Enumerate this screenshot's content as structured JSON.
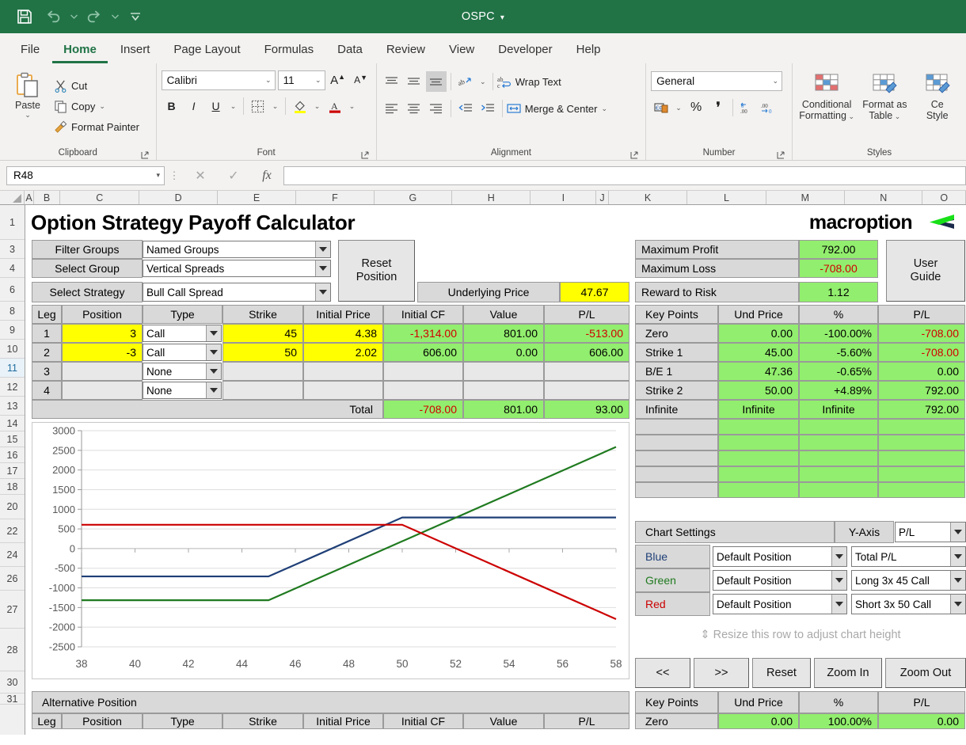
{
  "titlebar": {
    "doc_title": "OSPC",
    "caret": "▾",
    "qat": [
      {
        "name": "save-icon",
        "label": "Save"
      },
      {
        "name": "undo-icon",
        "label": "Undo"
      },
      {
        "name": "redo-icon",
        "label": "Redo"
      },
      {
        "name": "customize-qat-icon",
        "label": "Customize Quick Access Toolbar"
      }
    ],
    "accent": "#217346"
  },
  "ribbon": {
    "tabs": [
      {
        "label": "File",
        "active": false
      },
      {
        "label": "Home",
        "active": true
      },
      {
        "label": "Insert",
        "active": false
      },
      {
        "label": "Page Layout",
        "active": false
      },
      {
        "label": "Formulas",
        "active": false
      },
      {
        "label": "Data",
        "active": false
      },
      {
        "label": "Review",
        "active": false
      },
      {
        "label": "View",
        "active": false
      },
      {
        "label": "Developer",
        "active": false
      },
      {
        "label": "Help",
        "active": false
      }
    ],
    "clipboard": {
      "group_label": "Clipboard",
      "paste": "Paste",
      "cut": "Cut",
      "copy": "Copy",
      "format_painter": "Format Painter"
    },
    "font": {
      "group_label": "Font",
      "font_name": "Calibri",
      "font_size": "11",
      "grow": "A",
      "shrink": "A",
      "bold": "B",
      "italic": "I",
      "underline": "U",
      "borders": "Borders",
      "fill": "Fill Color",
      "fontcolor": "A"
    },
    "alignment": {
      "group_label": "Alignment",
      "wrap_text": "Wrap Text",
      "merge_center": "Merge & Center",
      "orientation": "Orientation",
      "indent_dec": "Decrease Indent",
      "indent_inc": "Increase Indent"
    },
    "number": {
      "group_label": "Number",
      "format": "General",
      "percent": "%",
      "comma": "❜",
      "dec_inc": ".00",
      "dec_dec": ".00"
    },
    "styles": {
      "group_label": "Styles",
      "conditional_formatting": "Conditional\nFormatting",
      "conditional_formatting_l1": "Conditional",
      "conditional_formatting_l2": "Formatting",
      "format_as_table_l1": "Format as",
      "format_as_table_l2": "Table",
      "cell_styles_l1": "Ce",
      "cell_styles_l2": "Style"
    }
  },
  "formula_bar": {
    "name_box": "R48",
    "cancel": "✕",
    "enter": "✓",
    "fx": "fx",
    "formula": ""
  },
  "grid": {
    "columns": [
      "A",
      "B",
      "C",
      "D",
      "E",
      "F",
      "G",
      "H",
      "I",
      "J",
      "K",
      "L",
      "M",
      "N",
      "O"
    ],
    "rows": [
      "1",
      "3",
      "4",
      "6",
      "8",
      "9",
      "10",
      "11",
      "12",
      "13",
      "14",
      "15",
      "16",
      "17",
      "18",
      "20",
      "22",
      "24",
      "26",
      "27",
      "28",
      "30",
      "31"
    ],
    "highlight_row": "11"
  },
  "sheet": {
    "title": "Option Strategy Payoff Calculator",
    "brand": "macroption",
    "filters": {
      "filter_groups_label": "Filter Groups",
      "filter_groups_value": "Named Groups",
      "select_group_label": "Select Group",
      "select_group_value": "Vertical Spreads",
      "select_strategy_label": "Select Strategy",
      "select_strategy_value": "Bull Call Spread",
      "reset_position_l1": "Reset",
      "reset_position_l2": "Position"
    },
    "underlying": {
      "label": "Underlying Price",
      "value": "47.67"
    },
    "legs": {
      "headers": [
        "Leg",
        "Position",
        "Type",
        "Strike",
        "Initial Price",
        "Initial CF",
        "Value",
        "P/L"
      ],
      "rows": [
        {
          "leg": "1",
          "position": "3",
          "type": "Call",
          "strike": "45",
          "initial_price": "4.38",
          "initial_cf": "-1,314.00",
          "value": "801.00",
          "pl": "-513.00",
          "cf_neg": true,
          "pl_neg": true
        },
        {
          "leg": "2",
          "position": "-3",
          "type": "Call",
          "strike": "50",
          "initial_price": "2.02",
          "initial_cf": "606.00",
          "value": "0.00",
          "pl": "606.00",
          "cf_neg": false,
          "pl_neg": false
        },
        {
          "leg": "3",
          "position": "",
          "type": "None",
          "strike": "",
          "initial_price": "",
          "initial_cf": "",
          "value": "",
          "pl": "",
          "cf_neg": false,
          "pl_neg": false
        },
        {
          "leg": "4",
          "position": "",
          "type": "None",
          "strike": "",
          "initial_price": "",
          "initial_cf": "",
          "value": "",
          "pl": "",
          "cf_neg": false,
          "pl_neg": false
        }
      ],
      "total_label": "Total",
      "total_cf": "-708.00",
      "total_value": "801.00",
      "total_pl": "93.00"
    },
    "summary": {
      "max_profit_label": "Maximum Profit",
      "max_profit_value": "792.00",
      "max_loss_label": "Maximum Loss",
      "max_loss_value": "-708.00",
      "reward_risk_label": "Reward to Risk",
      "reward_risk_value": "1.12",
      "user_guide_l1": "User",
      "user_guide_l2": "Guide"
    },
    "key_points": {
      "headers": [
        "Key Points",
        "Und Price",
        "%",
        "P/L"
      ],
      "rows": [
        {
          "name": "Zero",
          "und": "0.00",
          "pct": "-100.00%",
          "pl": "-708.00",
          "pl_neg": true
        },
        {
          "name": "Strike 1",
          "und": "45.00",
          "pct": "-5.60%",
          "pl": "-708.00",
          "pl_neg": true
        },
        {
          "name": "B/E 1",
          "und": "47.36",
          "pct": "-0.65%",
          "pl": "0.00",
          "pl_neg": false
        },
        {
          "name": "Strike 2",
          "und": "50.00",
          "pct": "+4.89%",
          "pl": "792.00",
          "pl_neg": false
        },
        {
          "name": "Infinite",
          "und": "Infinite",
          "pct": "Infinite",
          "pl": "792.00",
          "pl_neg": false
        },
        {
          "name": "",
          "und": "",
          "pct": "",
          "pl": "",
          "pl_neg": false
        },
        {
          "name": "",
          "und": "",
          "pct": "",
          "pl": "",
          "pl_neg": false
        },
        {
          "name": "",
          "und": "",
          "pct": "",
          "pl": "",
          "pl_neg": false
        },
        {
          "name": "",
          "und": "",
          "pct": "",
          "pl": "",
          "pl_neg": false
        },
        {
          "name": "",
          "und": "",
          "pct": "",
          "pl": "",
          "pl_neg": false
        }
      ]
    },
    "chart_settings": {
      "title": "Chart Settings",
      "yaxis_label": "Y-Axis",
      "yaxis_value": "P/L",
      "series": [
        {
          "color_name": "Blue",
          "color": "#1f3f77",
          "position": "Default Position",
          "item": "Total P/L"
        },
        {
          "color_name": "Green",
          "color": "#1f7a1f",
          "position": "Default Position",
          "item": "Long 3x 45 Call"
        },
        {
          "color_name": "Red",
          "color": "#cc0000",
          "position": "Default Position",
          "item": "Short 3x 50 Call"
        }
      ],
      "resize_hint": "⇕ Resize this row to adjust chart height"
    },
    "chart_buttons": [
      "<<",
      ">>",
      "Reset",
      "Zoom In",
      "Zoom Out"
    ],
    "bottom": {
      "alt_position_title": "Alternative Position",
      "alt_headers": [
        "Leg",
        "Position",
        "Type",
        "Strike",
        "Initial Price",
        "Initial CF",
        "Value",
        "P/L"
      ],
      "kp_headers": [
        "Key Points",
        "Und Price",
        "%",
        "P/L"
      ],
      "kp_row": {
        "name": "Zero",
        "und": "0.00",
        "pct": "100.00%",
        "pl": "0.00"
      }
    }
  },
  "chart_data": {
    "type": "line",
    "title": "",
    "xlabel": "",
    "ylabel": "P/L",
    "xlim": [
      38,
      58
    ],
    "ylim": [
      -2500,
      3000
    ],
    "xticks": [
      38,
      40,
      42,
      44,
      46,
      48,
      50,
      52,
      54,
      56,
      58
    ],
    "yticks": [
      3000,
      2500,
      2000,
      1500,
      1000,
      500,
      0,
      -500,
      -1000,
      -1500,
      -2000,
      -2500
    ],
    "grid": true,
    "legend": "none",
    "series": [
      {
        "name": "Total P/L",
        "color": "#1f3f77",
        "x": [
          38,
          45,
          50,
          58
        ],
        "y": [
          -708,
          -708,
          792,
          792
        ]
      },
      {
        "name": "Long 3x 45 Call",
        "color": "#1f7a1f",
        "x": [
          38,
          45,
          58
        ],
        "y": [
          -1314,
          -1314,
          2586
        ]
      },
      {
        "name": "Short 3x 50 Call",
        "color": "#cc0000",
        "x": [
          38,
          50,
          58
        ],
        "y": [
          606,
          606,
          -1794
        ]
      }
    ]
  }
}
